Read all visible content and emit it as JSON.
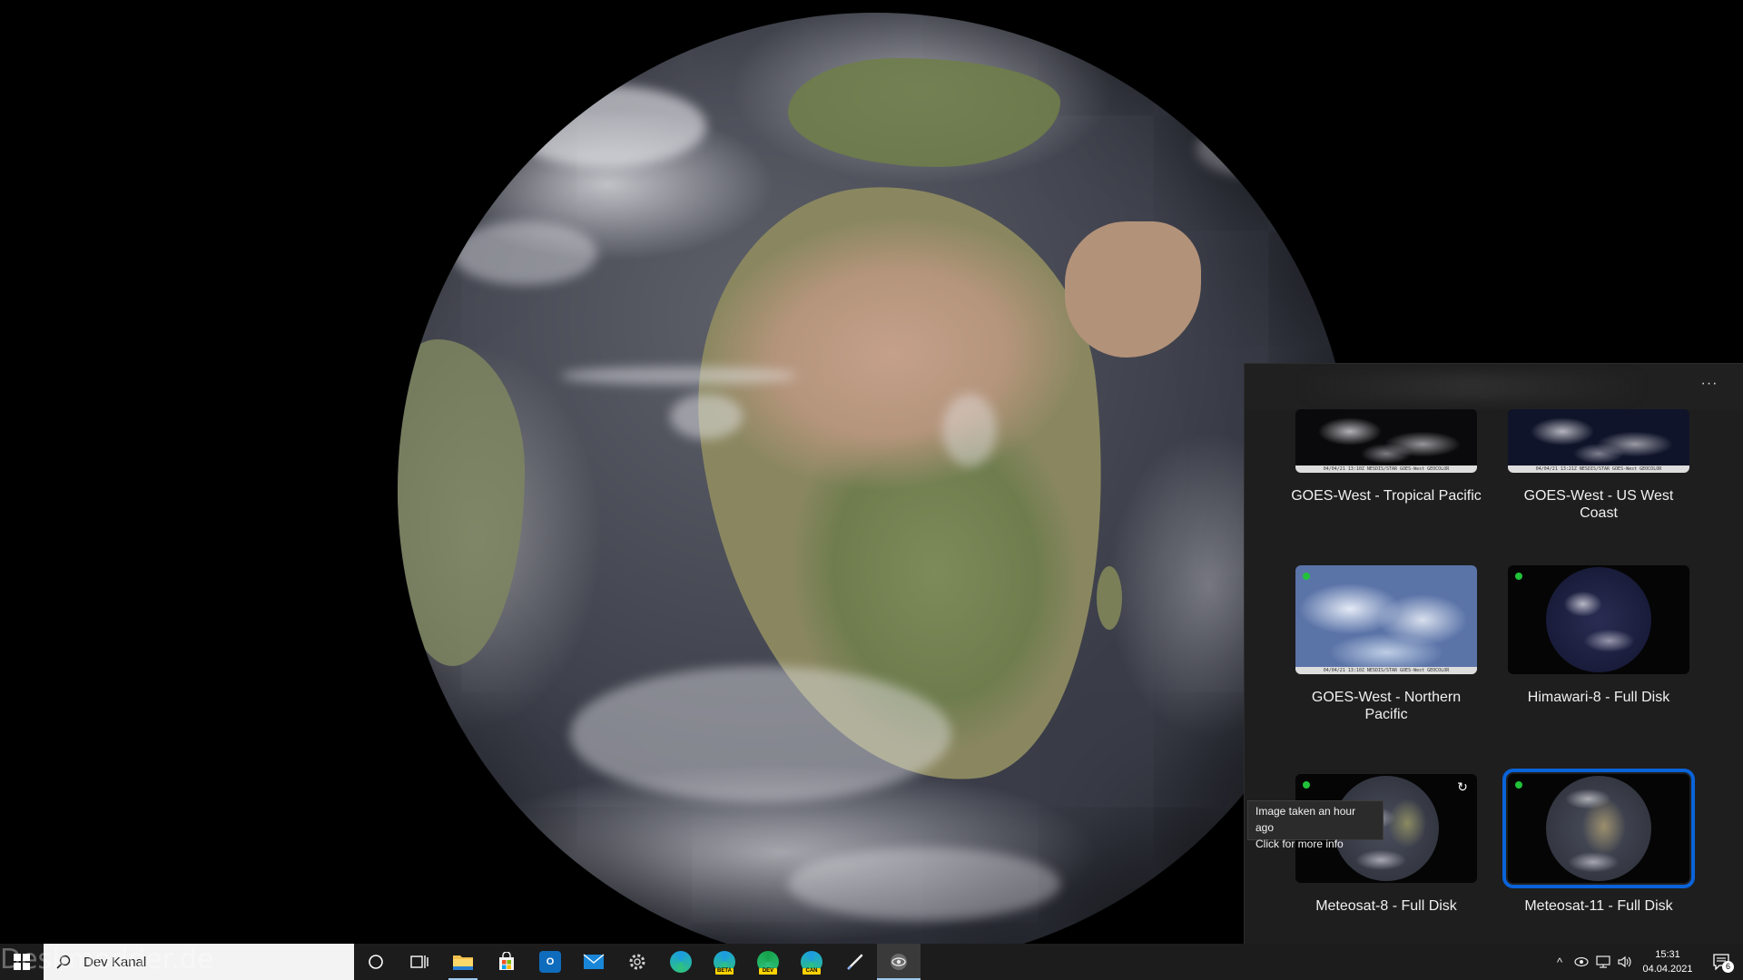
{
  "watermark": "Deskmodder.de",
  "panel": {
    "more_label": "···",
    "tiles": [
      {
        "label": "GOES-West - Tropical Pacific",
        "caption": "04/04/21 13:10Z NESDIS/STAR GOES-West GEOCOLOR",
        "live": false,
        "selected": false
      },
      {
        "label": "GOES-West - US West Coast",
        "caption": "04/04/21 13:21Z NESDIS/STAR GOES-West GEOCOLOR",
        "live": false,
        "selected": false
      },
      {
        "label": "GOES-West - Northern Pacific",
        "caption": "04/04/21 13:10Z NESDIS/STAR GOES-West GEOCOLOR",
        "live": true,
        "selected": false
      },
      {
        "label": "Himawari-8 - Full Disk",
        "caption": "",
        "live": true,
        "selected": false
      },
      {
        "label": "Meteosat-8 - Full Disk",
        "caption": "",
        "live": true,
        "selected": false
      },
      {
        "label": "Meteosat-11 - Full Disk",
        "caption": "",
        "live": true,
        "selected": true
      }
    ],
    "tooltip": {
      "line1": "Image taken an hour ago",
      "line2": "Click for more info"
    }
  },
  "taskbar": {
    "search_text": "Dev Kanal",
    "apps": [
      {
        "name": "cortana-button",
        "icon": "circle-icon",
        "running": false,
        "active": false
      },
      {
        "name": "task-view-button",
        "icon": "task-view-icon",
        "running": false,
        "active": false
      },
      {
        "name": "file-explorer-button",
        "icon": "folder-icon",
        "color": "#f2c14e",
        "running": true,
        "active": false
      },
      {
        "name": "store-button",
        "icon": "store-icon",
        "color": "#f2f2f2",
        "running": false,
        "active": false
      },
      {
        "name": "outlook-button",
        "icon": "outlook-icon",
        "color": "#0f6cbd",
        "running": false,
        "active": false
      },
      {
        "name": "mail-button",
        "icon": "mail-icon",
        "color": "#1a86d8",
        "running": false,
        "active": false
      },
      {
        "name": "settings-button",
        "icon": "gear-icon",
        "color": "#b5b5b5",
        "running": false,
        "active": false
      },
      {
        "name": "edge-button",
        "icon": "edge-icon",
        "color": "#1b9de2",
        "running": false,
        "active": false
      },
      {
        "name": "edge-beta-button",
        "icon": "edge-beta-icon",
        "badge": "BETA",
        "color": "#1b9de2",
        "running": false,
        "active": false
      },
      {
        "name": "edge-dev-button",
        "icon": "edge-dev-icon",
        "badge": "DEV",
        "color": "#16a34a",
        "running": false,
        "active": false
      },
      {
        "name": "edge-canary-button",
        "icon": "edge-canary-icon",
        "badge": "CAN",
        "color": "#1b9de2",
        "running": false,
        "active": false
      },
      {
        "name": "pen-app-button",
        "icon": "pen-icon",
        "running": false,
        "active": false
      },
      {
        "name": "satellite-app-button",
        "icon": "eye-icon",
        "running": true,
        "active": true
      }
    ],
    "tray": {
      "chevron": "^",
      "time": "15:31",
      "date": "04.04.2021",
      "notifications": "6"
    }
  }
}
